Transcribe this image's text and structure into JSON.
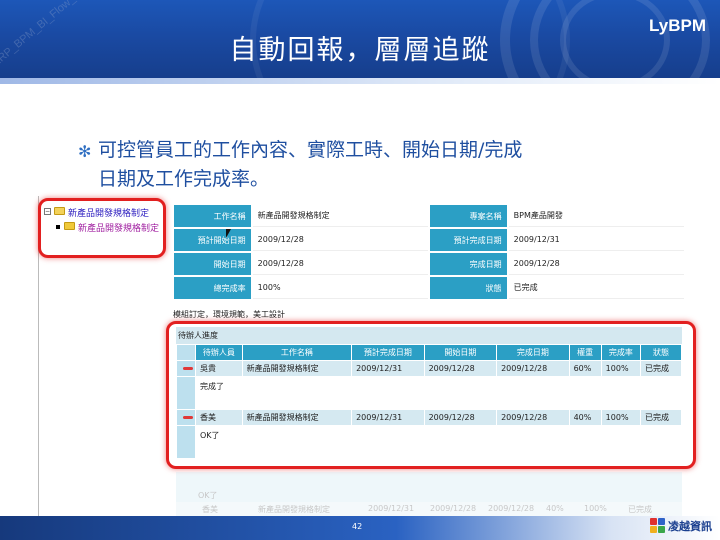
{
  "header": {
    "title": "自動回報，層層追蹤",
    "brand": "LyBPM",
    "watermark": "ERP_BPM_BI_Flow_..."
  },
  "bullet": {
    "line1": "可控管員工的工作內容、實際工時、開始日期/完成",
    "line2": "日期及工作完成率。"
  },
  "tree": {
    "root_label": "新產品開發規格制定",
    "child_label": "新產品開發規格制定"
  },
  "info": {
    "rows": [
      {
        "l1": "工作名稱",
        "v1": "新產品開發規格制定",
        "l2": "專案名稱",
        "v2": "BPM產品開發"
      },
      {
        "l1": "預計開始日期",
        "v1": "2009/12/28",
        "l2": "預計完成日期",
        "v2": "2009/12/31"
      },
      {
        "l1": "開始日期",
        "v1": "2009/12/28",
        "l2": "完成日期",
        "v2": "2009/12/28"
      },
      {
        "l1": "總完成率",
        "v1": "100%",
        "l2": "狀態",
        "v2": "已完成"
      }
    ],
    "note": "模組訂定，環境規範，美工設計"
  },
  "progress": {
    "title": "待辦人進度",
    "columns": [
      "待辦人員",
      "工作名稱",
      "預計完成日期",
      "開始日期",
      "完成日期",
      "權重",
      "完成率",
      "狀態"
    ],
    "rows": [
      {
        "cells": [
          "吳貴",
          "新產品開發規格制定",
          "2009/12/31",
          "2009/12/28",
          "2009/12/28",
          "60%",
          "100%",
          "已完成"
        ],
        "comment": "完成了"
      },
      {
        "cells": [
          "香美",
          "新產品開發規格制定",
          "2009/12/31",
          "2009/12/28",
          "2009/12/28",
          "40%",
          "100%",
          "已完成"
        ],
        "comment": "OK了"
      }
    ]
  },
  "reflection": {
    "comment": "OK了",
    "cells": [
      "香美",
      "新產品開發規格制定",
      "2009/12/31",
      "2009/12/28",
      "2009/12/28",
      "40%",
      "100%",
      "已完成"
    ]
  },
  "footer": {
    "page": "42",
    "company": "凌越資訊"
  },
  "colors": {
    "header_blue": "#1a4aa3",
    "table_header": "#2b9fc5",
    "highlight_red": "#e22020"
  }
}
